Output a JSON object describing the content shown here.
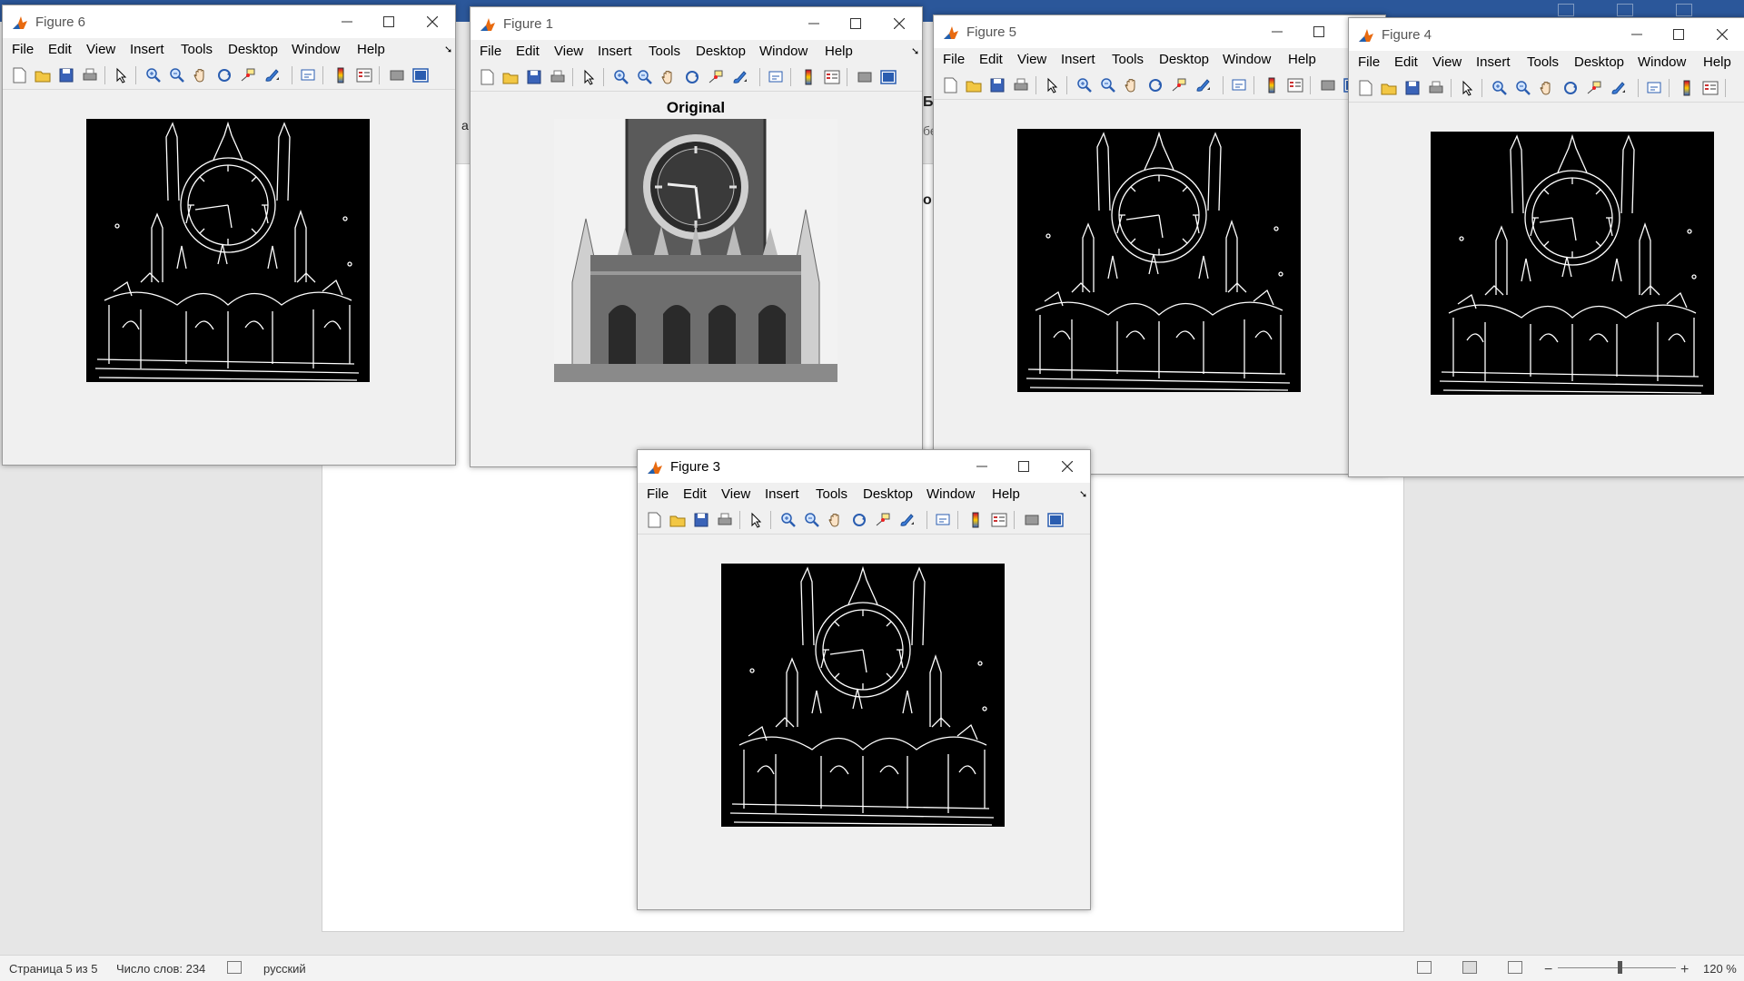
{
  "word": {
    "snippet_1": "Б",
    "snippet_2": "а",
    "snippet_3": "бе",
    "snippet_4": "o",
    "status": {
      "page": "Страница 5 из 5",
      "words": "Число слов: 234",
      "language": "русский",
      "zoom": "120 %",
      "zoom_minus": "−",
      "zoom_plus": "+"
    }
  },
  "menu": [
    "File",
    "Edit",
    "View",
    "Insert",
    "Tools",
    "Desktop",
    "Window",
    "Help"
  ],
  "figures": {
    "fig6": {
      "title": "Figure 6"
    },
    "fig1": {
      "title": "Figure 1",
      "axes_title": "Original"
    },
    "fig5": {
      "title": "Figure 5"
    },
    "fig4": {
      "title": "Figure 4"
    },
    "fig3": {
      "title": "Figure 3"
    }
  },
  "colors": {
    "word_blue": "#2b579a",
    "matlab_orange": "#e86a10",
    "edge_bg": "#000000",
    "edge_line": "#ffffff"
  }
}
